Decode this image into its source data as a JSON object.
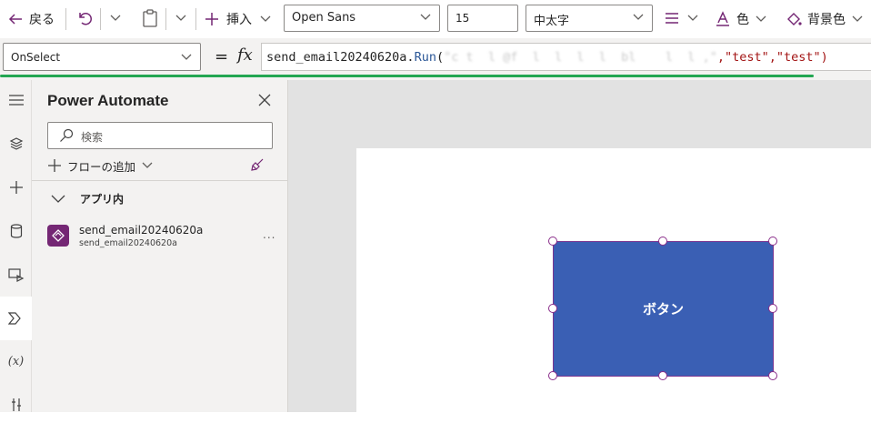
{
  "toolbar": {
    "back_label": "戻る",
    "insert_label": "挿入",
    "font": "Open Sans",
    "font_size": "15",
    "font_weight": "中太字",
    "color_label": "色",
    "fill_label": "背景色"
  },
  "formula_bar": {
    "property": "OnSelect",
    "fx": "fx",
    "equals": "=",
    "code_prefix": "send_email20240620a.",
    "code_fn": "Run",
    "code_open": "(",
    "code_masked": "\"c t  l @f  l  l  l  l  bl    l  l ,\"",
    "code_args": ",\"test\",\"test\")"
  },
  "panel": {
    "title": "Power Automate",
    "search_placeholder": "検索",
    "add_flow_label": "フローの追加",
    "section_label": "アプリ内",
    "flow": {
      "name": "send_email20240620a",
      "subtitle": "send_email20240620a",
      "more": "..."
    }
  },
  "canvas": {
    "button_label": "ボタン",
    "button_color": "#3a5fb4",
    "selection_color": "#8a2d8a"
  },
  "colors": {
    "accent": "#742774",
    "formula_underline": "#23a652"
  }
}
